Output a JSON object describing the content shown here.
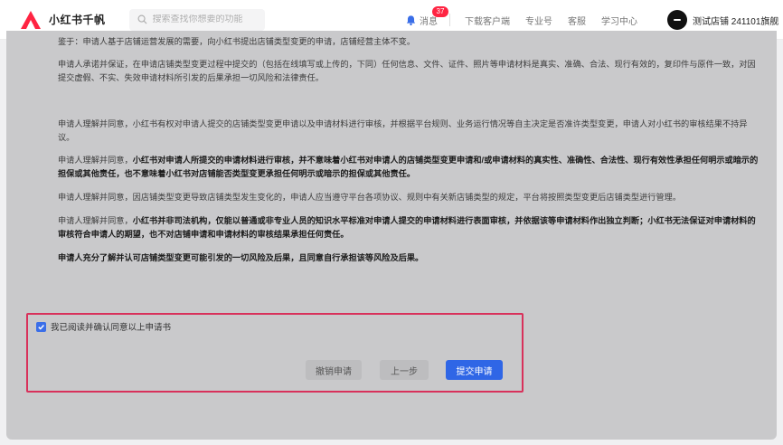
{
  "header": {
    "brand": "小红书千帆",
    "search_placeholder": "搜索查找你想要的功能",
    "messages_label": "消息",
    "messages_count": "37",
    "nav_links": [
      "下载客户端",
      "专业号",
      "客服",
      "学习中心"
    ],
    "user_name": "测试店铺 241101旗舰"
  },
  "document": {
    "p1": "鉴于：申请人基于店铺运营发展的需要，向小红书提出店铺类型变更的申请，店铺经营主体不变。",
    "p2": "申请人承诺并保证，在申请店铺类型变更过程中提交的（包括在线填写或上传的，下同）任何信息、文件、证件、照片等申请材料是真实、准确、合法、现行有效的，复印件与原件一致，对因提交虚假、不实、失效申请材料所引发的后果承担一切风险和法律责任。",
    "p3": "申请人理解并同意，小红书有权对申请人提交的店铺类型变更申请以及申请材料进行审核，并根据平台规则、业务运行情况等自主决定是否准许类型变更，申请人对小红书的审核结果不持异议。",
    "p4_pre": "申请人理解并同意，",
    "p4_bold": "小红书对申请人所提交的申请材料进行审核，并不意味着小红书对申请人的店铺类型变更申请和/或申请材料的真实性、准确性、合法性、现行有效性承担任何明示或暗示的担保或其他责任，也不意味着小红书对店铺能否类型变更承担任何明示或暗示的担保或其他责任。",
    "p5": "申请人理解并同意，因店铺类型变更导致店铺类型发生变化的，申请人应当遵守平台各项协议、规则中有关新店铺类型的规定，平台将按照类型变更后店铺类型进行管理。",
    "p6_pre": "申请人理解并同意，",
    "p6_bold": "小红书并非司法机构，仅能以普通或非专业人员的知识水平标准对申请人提交的申请材料进行表面审核，并依据该等申请材料作出独立判断；小红书无法保证对申请材料的审核符合申请人的期望，也不对店铺申请和申请材料的审核结果承担任何责任。",
    "p7": "申请人充分了解并认可店铺类型变更可能引发的一切风险及后果，且同意自行承担该等风险及后果。"
  },
  "confirm": {
    "checkbox_label": "我已阅读并确认同意以上申请书",
    "checked": true,
    "cancel_label": "撤销申请",
    "prev_label": "上一步",
    "submit_label": "提交申请"
  },
  "colors": {
    "brand_red": "#ff2442",
    "primary_blue": "#2f66e6",
    "highlight_border": "#d8315b"
  }
}
